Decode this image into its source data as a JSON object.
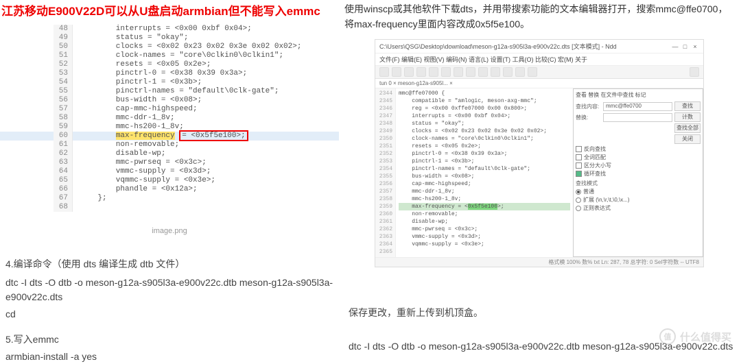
{
  "left": {
    "title": "江苏移动E900V22D可以从U盘启动armbian但不能写入emmc",
    "code_start_line": 48,
    "code_lines": [
      "        interrupts = <0x00 0xbf 0x04>;",
      "        status = \"okay\";",
      "        clocks = <0x02 0x23 0x02 0x3e 0x02 0x02>;",
      "        clock-names = \"core\\0clkin0\\0clkin1\";",
      "        resets = <0x05 0x2e>;",
      "        pinctrl-0 = <0x38 0x39 0x3a>;",
      "        pinctrl-1 = <0x3b>;",
      "        pinctrl-names = \"default\\0clk-gate\";",
      "        bus-width = <0x08>;",
      "        cap-mmc-highspeed;",
      "        mmc-ddr-1_8v;",
      "        mmc-hs200-1_8v;",
      "        max-frequency = <0x5f5e100>;",
      "        non-removable;",
      "        disable-wp;",
      "        mmc-pwrseq = <0x3c>;",
      "        vmmc-supply = <0x3d>;",
      "        vqmmc-supply = <0x3e>;",
      "        phandle = <0x12a>;",
      "    };",
      ""
    ],
    "highlight_line_index": 12,
    "highlight_token": "max-frequency",
    "redbox_token": "= <0x5f5e100>;",
    "caption": "image.png",
    "step4_label": "4.编译命令（使用 dts 编译生成 dtb 文件）",
    "compile_cmd": "dtc -I dts -O dtb -o meson-g12a-s905l3a-e900v22c.dtb meson-g12a-s905l3a-e900v22c.dts",
    "cd_cmd": "cd",
    "step5_label": "5.写入emmc",
    "install_cmd": "armbian-install -a yes"
  },
  "right": {
    "instruction": "使用winscp或其他软件下载dts，并用带搜索功能的文本编辑器打开，搜索mmc@ffe0700，将max-frequency里面内容改成0x5f5e100。",
    "editor": {
      "title": "C:\\Users\\QSG\\Desktop\\download\\meson-g12a-s905l3a-e900v22c.dts [文本模式] - Ndd",
      "menubar": "文件(F)  编辑(E)  视图(V)  编码(N)  语言(L)  设置(T)  工具(O)  比较(C)  宏(M)  关于",
      "tab": "tun 0 ×    meson-g12a-s905l... ×",
      "gutter_start": 2344,
      "code_lines": [
        "",
        "mmc@ffe07000 {",
        "    compatible = \"amlogic, meson-axg-mmc\";",
        "    reg = <0x00 0xffe07000 0x00 0x800>;",
        "    interrupts = <0x00 0xbf 0x04>;",
        "    status = \"okay\";",
        "    clocks = <0x02 0x23 0x02 0x3e 0x02 0x02>;",
        "    clock-names = \"core\\0clkin0\\0clkin1\";",
        "    resets = <0x05 0x2e>;",
        "    pinctrl-0 = <0x38 0x39 0x3a>;",
        "    pinctrl-1 = <0x3b>;",
        "    pinctrl-names = \"default\\0clk-gate\";",
        "    bus-width = <0x08>;",
        "    cap-mmc-highspeed;",
        "    mmc-ddr-1_8v;",
        "    mmc-hs200-1_8v;",
        "    max-frequency = <0x5f5e100>;",
        "    non-removable;",
        "    disable-wp;",
        "    mmc-pwrseq = <0x3c>;",
        "    vmmc-supply = <0x3d>;",
        "    vqmmc-supply = <0x3e>;"
      ],
      "highlight_line_index": 16,
      "highlight_prefix": "    max-frequency = <",
      "highlight_token": "0x5f5e100",
      "highlight_suffix": ">;",
      "find": {
        "tabs": "查看  替换  在文件中查找  标记",
        "find_label": "查找内容:",
        "find_value": "mmc@ffe0700",
        "replace_label": "替换:",
        "btn_find": "查找",
        "btn_count": "计数",
        "btn_findall": "查找全部",
        "btn_close": "关闭",
        "chk_backward": "反向查找",
        "chk_wholeword": "全词匹配",
        "chk_case": "区分大小写",
        "chk_wrap": "循环查找",
        "mode_label": "查找模式",
        "mode_normal": "普通",
        "mode_ext": "扩展 (\\n,\\r,\\t,\\0,\\x...)",
        "mode_regex": "正则表达式"
      },
      "statusbar": "格式模 100% 数%   txt   Ln: 287, 78 总字符:   0 Sel字符数 --  UTF8"
    },
    "save_text": "保存更改，重新上传到机顶盒。",
    "compile_cmd": "dtc -I dts -O dtb -o meson-g12a-s905l3a-e900v22c.dtb meson-g12a-s905l3a-e900v22c.dts"
  },
  "watermark": {
    "logo": "值",
    "site": "什么值得买"
  }
}
